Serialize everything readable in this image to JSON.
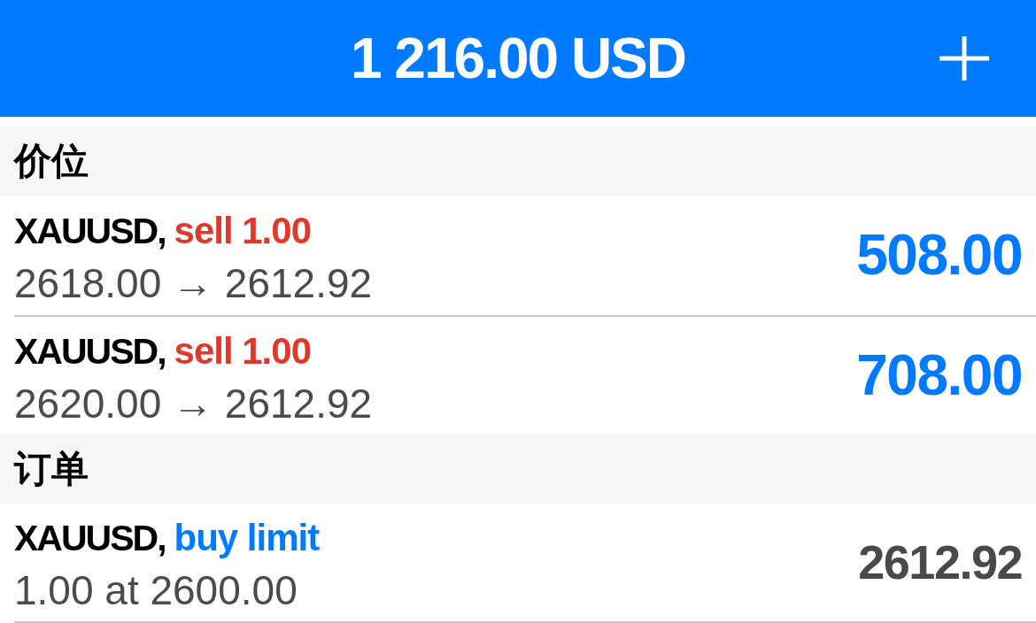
{
  "header": {
    "title": "1 216.00 USD"
  },
  "sections": [
    {
      "title": "价位",
      "rows": [
        {
          "kind": "position",
          "symbol": "XAUUSD,",
          "action": {
            "text": "sell 1.00",
            "color": "#e0382a"
          },
          "detail": "2618.00 → 2612.92",
          "value": {
            "text": "508.00",
            "color": "#007aff"
          }
        },
        {
          "kind": "position",
          "symbol": "XAUUSD,",
          "action": {
            "text": "sell 1.00",
            "color": "#e0382a"
          },
          "detail": "2620.00 → 2612.92",
          "value": {
            "text": "708.00",
            "color": "#007aff"
          }
        }
      ]
    },
    {
      "title": "订单",
      "rows": [
        {
          "kind": "order",
          "symbol": "XAUUSD,",
          "action": {
            "text": "buy limit",
            "color": "#007aff"
          },
          "detail": "1.00 at 2600.00",
          "value": {
            "text": "2612.92",
            "color": "#48484d"
          }
        }
      ]
    }
  ]
}
